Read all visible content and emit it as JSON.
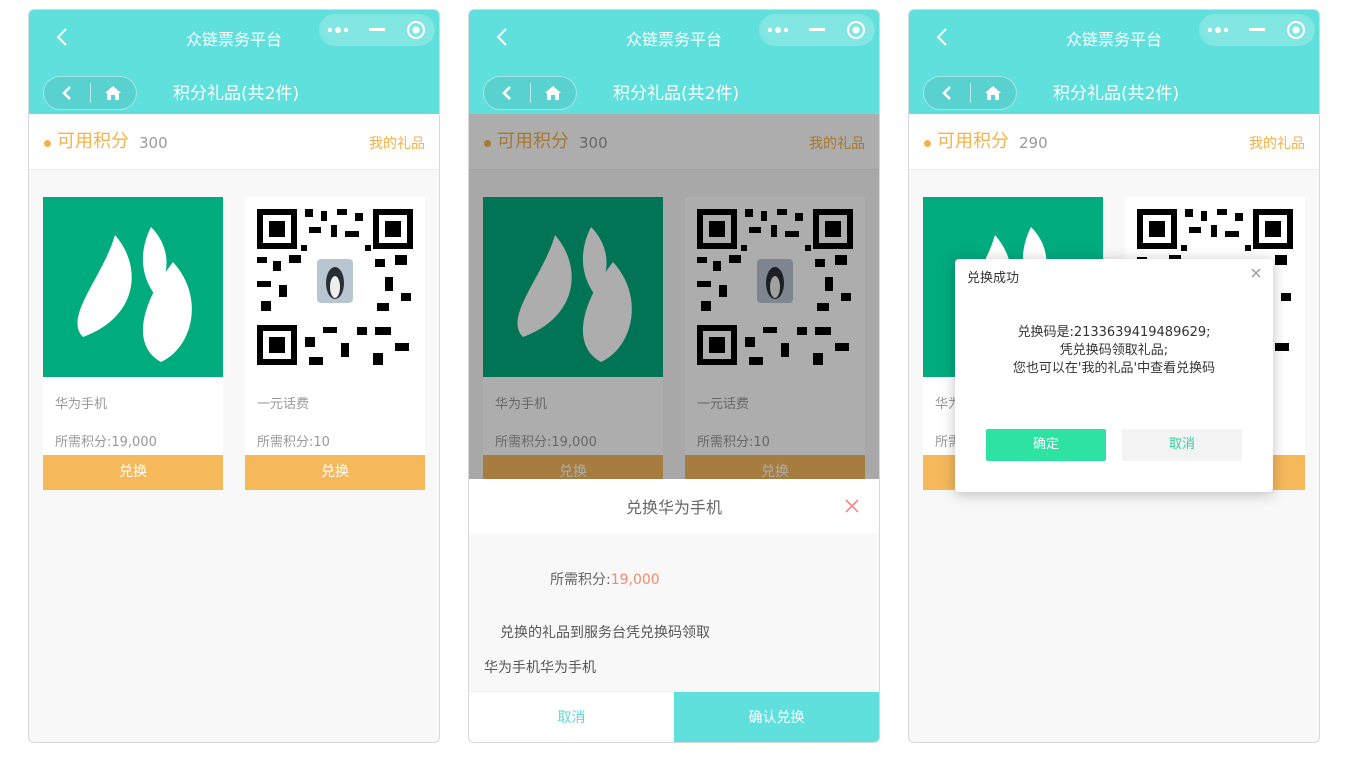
{
  "app_title": "众链票务平台",
  "page_title": "积分礼品(共2件)",
  "points_label": "可用积分",
  "my_gifts_label": "我的礼品",
  "screens": [
    {
      "points_value": "300"
    },
    {
      "points_value": "300"
    },
    {
      "points_value": "290"
    }
  ],
  "gifts": [
    {
      "name": "华为手机",
      "points": "所需积分:19,000",
      "button": "兑换",
      "image_icon": "green-leaf-logo"
    },
    {
      "name": "一元话费",
      "points": "所需积分:10",
      "button": "兑换",
      "image_icon": "qr-code-penguin"
    }
  ],
  "sheet": {
    "title": "兑换华为手机",
    "required_label": "所需积分:",
    "required_value": "19,000",
    "note": "兑换的礼品到服务台凭兑换码领取",
    "description": "华为手机华为手机",
    "cancel": "取消",
    "confirm": "确认兑换"
  },
  "dialog": {
    "title": "兑换成功",
    "line1": "兑换码是:2133639419489629;",
    "line2": "凭兑换码领取礼品;",
    "line3": "您也可以在'我的礼品'中查看兑换码",
    "ok": "确定",
    "cancel": "取消"
  },
  "colors": {
    "header": "#5fe0dc",
    "accent_orange": "#f5b24a",
    "button_orange": "#f5b95c",
    "brand_green": "#00ab7e",
    "success_green": "#2ee2a2"
  }
}
